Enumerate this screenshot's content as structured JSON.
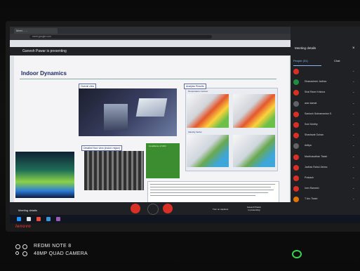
{
  "browser": {
    "tab_title": "Meet - ...",
    "url": "meet.google.com"
  },
  "meet": {
    "presenter_banner": "Ganesh Pawar is presenting",
    "meeting_details": "Meeting details",
    "people_tab": "People (31)",
    "chat_tab": "Chat",
    "bottom_meeting_details": "Meeting details",
    "captions_label": "Turn on captions",
    "presenting_label": "Ganesh Pawar\nis presenting",
    "participants": [
      "",
      "Dhanashree Jadhav",
      "Shal Rane Krishna",
      "arav kamat",
      "Santosh Subramanian S.",
      "Soni Murthy",
      "Shashwat Guhan",
      "Aditya",
      "Madhusudhan Tiwari",
      "Jadhav Rahul Jishnu",
      "Prakash",
      "Iven Ramesh",
      "T Aru Tiwari"
    ]
  },
  "slide": {
    "title": "Indoor Dynamics",
    "overall_view": "Overall view",
    "analysis_results": "Analysis Results",
    "temperature_contour": "Temperature Contour",
    "velocity_vector": "Velocity Vector",
    "floor_plan_caption": "Detailed floor view (indoor region)",
    "green_caption": "Conditions of CFD"
  },
  "watermark": {
    "brand": "lenovo",
    "line1": "REDMI NOTE 8",
    "line2": "48MP QUAD CAMERA"
  },
  "colors": {
    "meet_bg": "#202124",
    "slide_title": "#1c2a63",
    "hangup_red": "#d93025",
    "link_blue": "#8ab4f8"
  }
}
